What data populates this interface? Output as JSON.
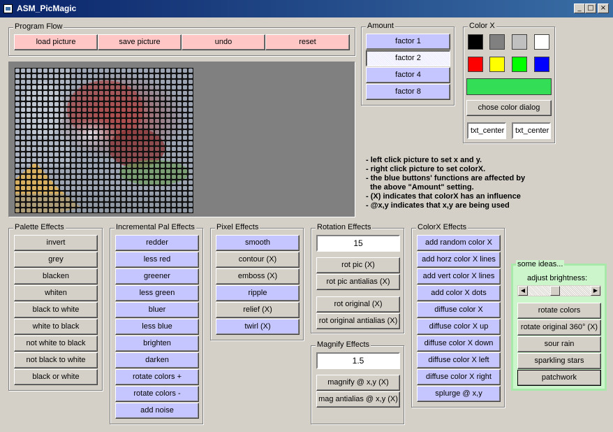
{
  "window": {
    "title": "ASM_PicMagic",
    "controls": {
      "minimize": "_",
      "maximize": "□",
      "close": "×"
    }
  },
  "program_flow": {
    "legend": "Program Flow",
    "buttons": [
      "load picture",
      "save picture",
      "undo",
      "reset"
    ]
  },
  "amount": {
    "legend": "Amount",
    "buttons": [
      "factor 1",
      "factor 2",
      "factor 4",
      "factor 8"
    ],
    "selected": "factor 2"
  },
  "colorx": {
    "legend": "Color X",
    "swatches": [
      "#000000",
      "#808080",
      "#c0c0c0",
      "#ffffff",
      "#ff0000",
      "#ffff00",
      "#00ff00",
      "#0000ff"
    ],
    "current_color": "#33dd55",
    "dialog_button": "chose color dialog",
    "txt_left": "txt_center",
    "txt_right": "txt_center"
  },
  "info_lines": [
    "- left click picture to set x and y.",
    "- right click picture to set colorX.",
    "- the blue buttons' functions are affected by",
    "  the above \"Amount\" setting.",
    "- (X) indicates that colorX has an influence",
    "- @x,y indicates that x,y are being used"
  ],
  "palette_effects": {
    "legend": "Palette Effects",
    "buttons": [
      "invert",
      "grey",
      "blacken",
      "whiten",
      "black to white",
      "white to black",
      "not white to black",
      "not black to white",
      "black or white"
    ]
  },
  "incremental_pal_effects": {
    "legend": "Incremental Pal Effects",
    "buttons": [
      "redder",
      "less red",
      "greener",
      "less green",
      "bluer",
      "less blue",
      "brighten",
      "darken",
      "rotate colors +",
      "rotate colors -",
      "add noise"
    ]
  },
  "pixel_effects": {
    "legend": "Pixel Effects",
    "buttons": [
      {
        "label": "smooth",
        "blue": true
      },
      {
        "label": "contour (X)",
        "blue": false
      },
      {
        "label": "emboss (X)",
        "blue": false
      },
      {
        "label": "ripple",
        "blue": true
      },
      {
        "label": "relief (X)",
        "blue": false
      },
      {
        "label": "twirl (X)",
        "blue": true
      }
    ]
  },
  "rotation_effects": {
    "legend": "Rotation Effects",
    "value": "15",
    "buttons": [
      "rot pic (X)",
      "rot pic antialias (X)",
      "rot original (X)",
      "rot original antialias (X)"
    ]
  },
  "magnify_effects": {
    "legend": "Magnify Effects",
    "value": "1.5",
    "buttons": [
      "magnify @ x,y (X)",
      "mag antialias @ x,y (X)"
    ]
  },
  "colorx_effects": {
    "legend": "ColorX Effects",
    "buttons": [
      "add random color X",
      "add horz color X lines",
      "add vert color X lines",
      "add color X dots",
      "diffuse color X",
      "diffuse color X up",
      "diffuse color X down",
      "diffuse color X left",
      "diffuse color X right",
      "splurge @ x,y"
    ]
  },
  "some_ideas": {
    "legend": "some ideas...",
    "brightness_label": "adjust brightness:",
    "brightness_level_percent": 42,
    "buttons": [
      "rotate colors",
      "rotate original 360° (X)",
      "sour rain",
      "sparkling stars",
      "patchwork"
    ]
  }
}
